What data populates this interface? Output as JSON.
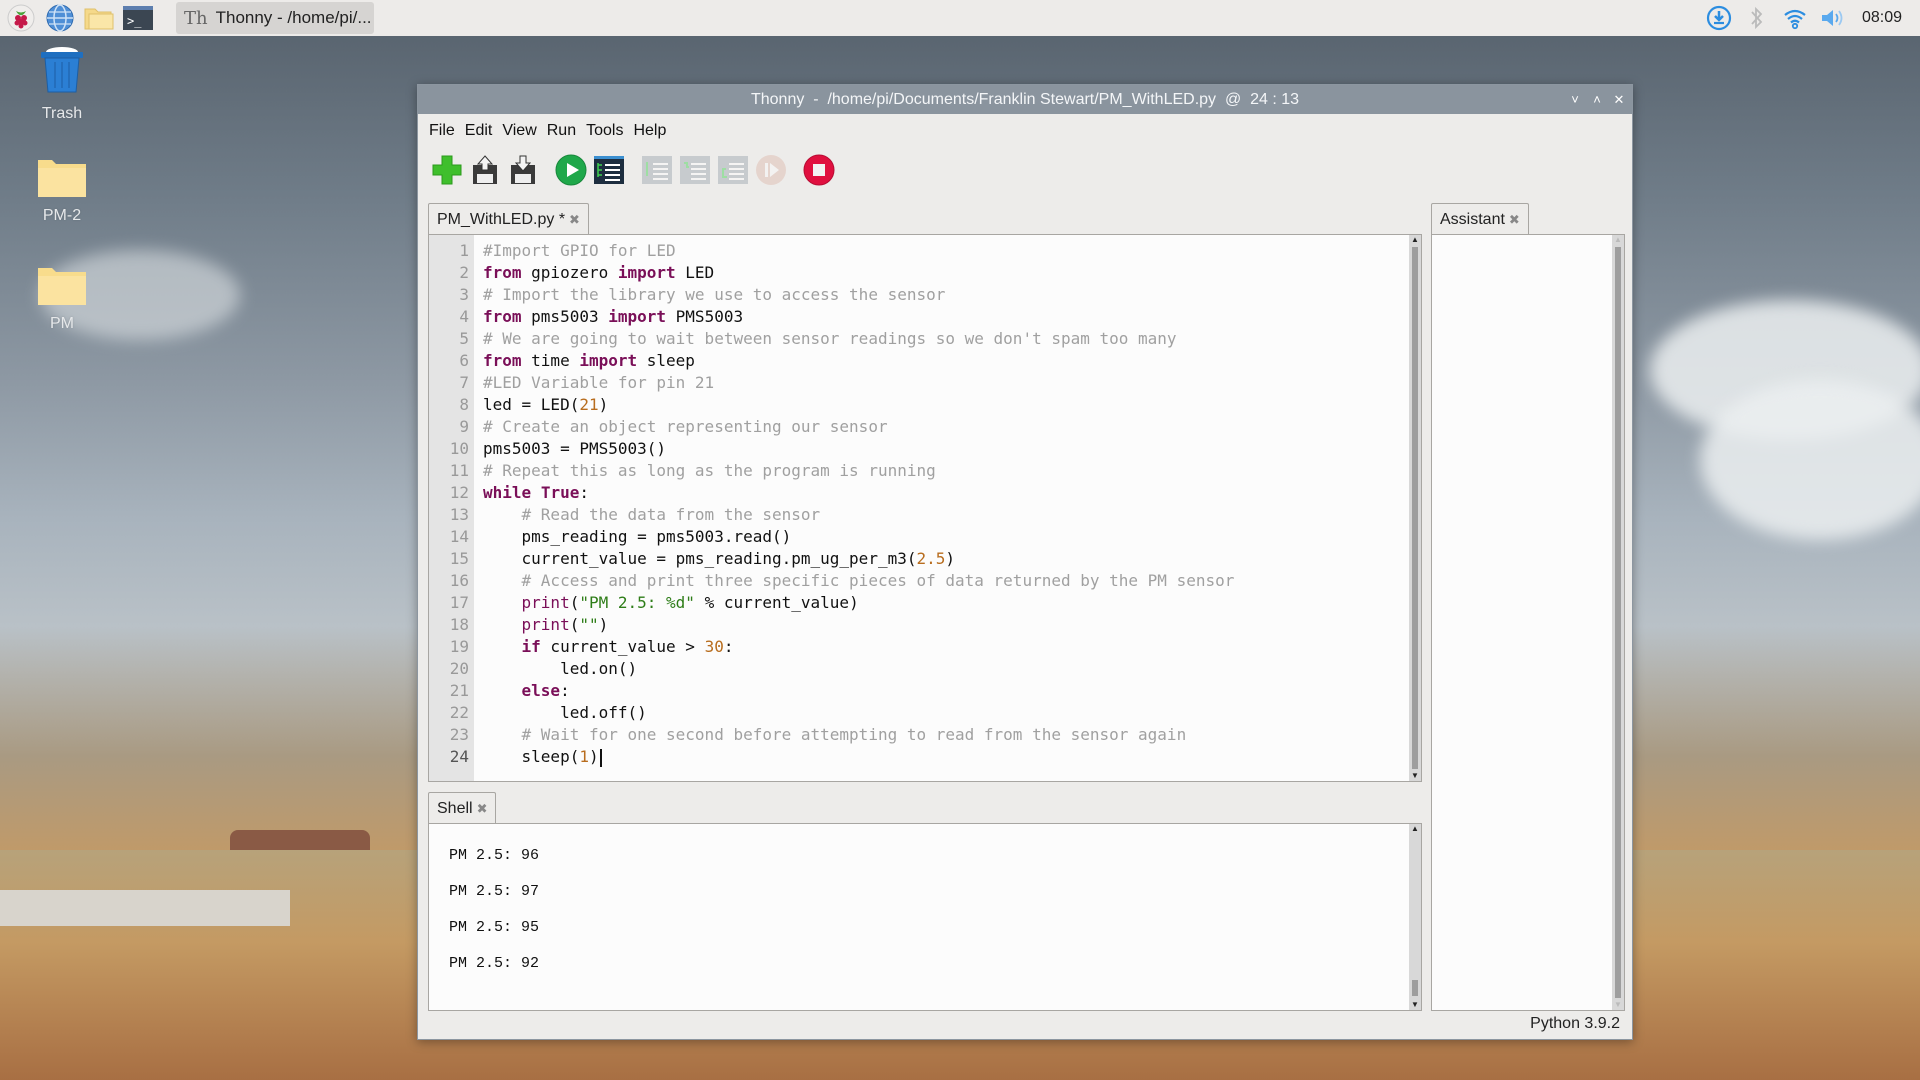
{
  "taskbar": {
    "launchers": [
      {
        "name": "raspberry-menu",
        "icon": "raspberry-icon"
      },
      {
        "name": "web-browser",
        "icon": "globe-icon"
      },
      {
        "name": "file-manager",
        "icon": "folder-icon"
      },
      {
        "name": "terminal",
        "icon": "terminal-icon"
      }
    ],
    "window_button": {
      "icon_glyph": "Th",
      "label": "Thonny  -  /home/pi/..."
    },
    "tray": {
      "clock": "08:09"
    }
  },
  "desktop": {
    "icons": [
      {
        "label": "Trash",
        "icon": "trash-icon"
      },
      {
        "label": "PM-2",
        "icon": "folder-icon"
      },
      {
        "label": "PM",
        "icon": "folder-icon"
      }
    ]
  },
  "window": {
    "title": "Thonny  -  /home/pi/Documents/Franklin Stewart/PM_WithLED.py  @  24 : 13",
    "controls": {
      "minimize": "˅",
      "maximize": "˄",
      "close": "✕"
    },
    "menu": [
      "File",
      "Edit",
      "View",
      "Run",
      "Tools",
      "Help"
    ],
    "toolbar": [
      {
        "name": "new",
        "enabled": true
      },
      {
        "name": "load",
        "enabled": true
      },
      {
        "name": "save",
        "enabled": true
      },
      {
        "name": "run",
        "enabled": true
      },
      {
        "name": "debug",
        "enabled": true
      },
      {
        "name": "step-over",
        "enabled": false
      },
      {
        "name": "step-into",
        "enabled": false
      },
      {
        "name": "step-out",
        "enabled": false
      },
      {
        "name": "resume",
        "enabled": false
      },
      {
        "name": "stop",
        "enabled": true
      }
    ],
    "editor": {
      "tab_label": "PM_WithLED.py *",
      "cursor_line": 24,
      "lines": [
        "#Import GPIO for LED",
        "from gpiozero import LED",
        "# Import the library we use to access the sensor",
        "from pms5003 import PMS5003",
        "# We are going to wait between sensor readings so we don't spam too many",
        "from time import sleep",
        "#LED Variable for pin 21",
        "led = LED(21)",
        "# Create an object representing our sensor",
        "pms5003 = PMS5003()",
        "# Repeat this as long as the program is running",
        "while True:",
        "    # Read the data from the sensor",
        "    pms_reading = pms5003.read()",
        "    current_value = pms_reading.pm_ug_per_m3(2.5)",
        "    # Access and print three specific pieces of data returned by the PM sensor",
        "    print(\"PM 2.5: %d\" % current_value)",
        "    print(\"\")",
        "    if current_value > 30:",
        "        led.on()",
        "    else:",
        "        led.off()",
        "    # Wait for one second before attempting to read from the sensor again",
        "    sleep(1)"
      ]
    },
    "shell": {
      "tab_label": "Shell",
      "output": [
        "PM 2.5: 96",
        "PM 2.5: 97",
        "PM 2.5: 95",
        "PM 2.5: 92"
      ]
    },
    "assistant": {
      "tab_label": "Assistant"
    },
    "status": {
      "interpreter": "Python 3.9.2"
    }
  }
}
